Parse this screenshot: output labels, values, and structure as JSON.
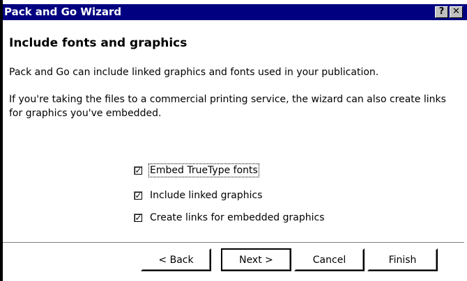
{
  "window": {
    "title": "Pack and Go Wizard",
    "help_glyph": "?",
    "close_glyph": "✕"
  },
  "content": {
    "heading": "Include fonts and graphics",
    "paragraph1": "Pack and Go can include linked graphics and fonts used in your publication.",
    "paragraph2": "If you're taking the files to a commercial printing service, the wizard can also create links for graphics you've embedded."
  },
  "options": [
    {
      "label": "Embed TrueType fonts",
      "checked": true
    },
    {
      "label": "Include linked graphics",
      "checked": true
    },
    {
      "label": "Create links for embedded graphics",
      "checked": true
    }
  ],
  "check_glyph": "✓",
  "buttons": {
    "back": "< Back",
    "next": "Next >",
    "cancel": "Cancel",
    "finish": "Finish"
  },
  "colors": {
    "titlebar": "#000080",
    "title_text": "#ffffff",
    "background": "#ffffff"
  }
}
